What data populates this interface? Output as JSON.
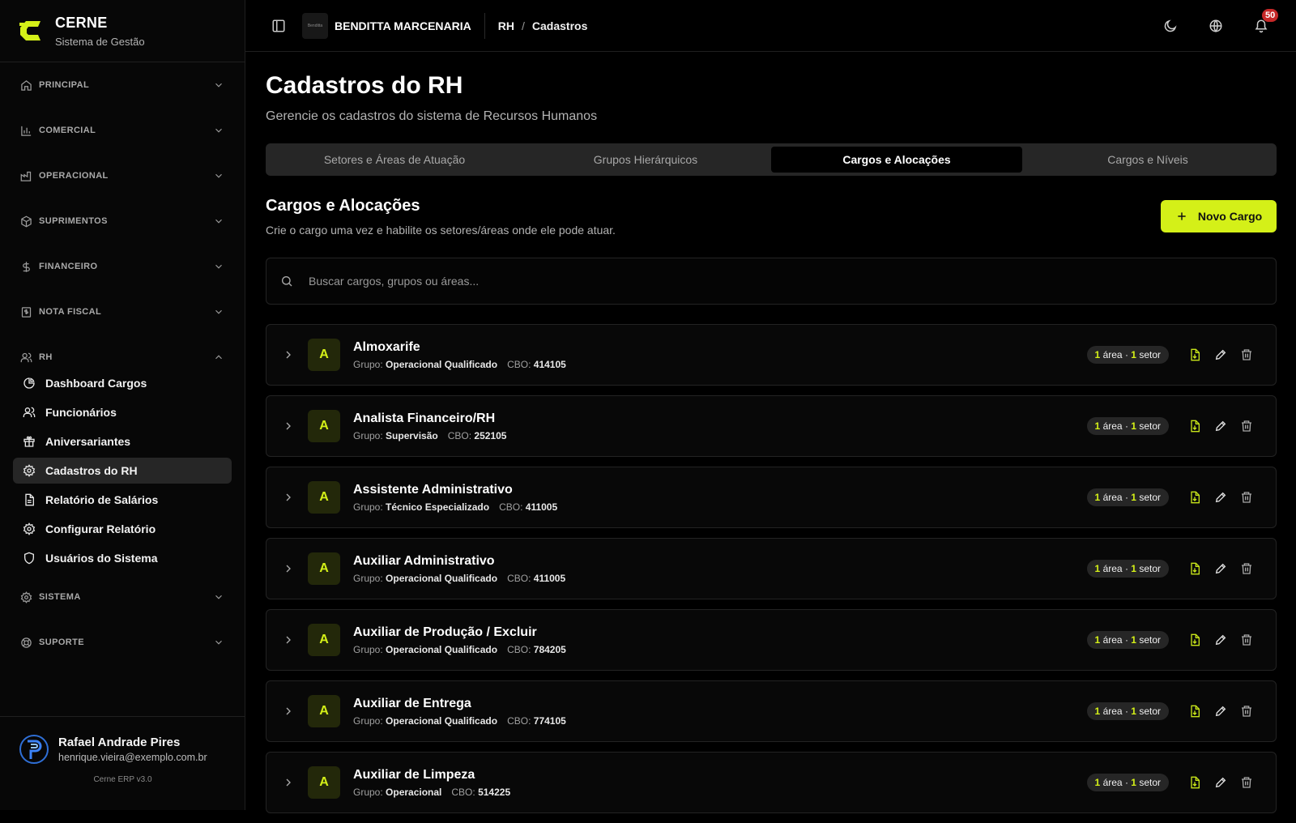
{
  "brand": {
    "name": "CERNE",
    "subtitle": "Sistema de Gestão"
  },
  "sidebar": {
    "sections_top": [
      {
        "label": "PRINCIPAL",
        "icon": "home-icon"
      },
      {
        "label": "COMERCIAL",
        "icon": "bar-chart-icon"
      },
      {
        "label": "OPERACIONAL",
        "icon": "factory-icon"
      },
      {
        "label": "SUPRIMENTOS",
        "icon": "package-icon"
      },
      {
        "label": "FINANCEIRO",
        "icon": "dollar-icon"
      },
      {
        "label": "NOTA FISCAL",
        "icon": "receipt-icon"
      }
    ],
    "rh": {
      "label": "RH",
      "expanded": true,
      "items": [
        {
          "label": "Dashboard Cargos",
          "icon": "pie-chart-icon"
        },
        {
          "label": "Funcionários",
          "icon": "users-icon"
        },
        {
          "label": "Aniversariantes",
          "icon": "gift-icon"
        },
        {
          "label": "Cadastros do RH",
          "icon": "gear-icon",
          "active": true
        },
        {
          "label": "Relatório de Salários",
          "icon": "document-icon"
        },
        {
          "label": "Configurar Relatório",
          "icon": "gear-icon"
        },
        {
          "label": "Usuários do Sistema",
          "icon": "shield-icon"
        }
      ]
    },
    "sections_bottom": [
      {
        "label": "SISTEMA",
        "icon": "gear-icon"
      },
      {
        "label": "SUPORTE",
        "icon": "lifebuoy-icon"
      }
    ],
    "user": {
      "name": "Rafael Andrade Pires",
      "email": "henrique.vieira@exemplo.com.br"
    },
    "version": "Cerne ERP v3.0"
  },
  "topbar": {
    "company_name": "BENDITTA MARCENARIA",
    "company_logo_text": "Benditta",
    "breadcrumb": [
      "RH",
      "Cadastros"
    ],
    "breadcrumb_sep": "/",
    "notification_count": "50"
  },
  "page": {
    "title": "Cadastros do RH",
    "subtitle": "Gerencie os cadastros do sistema de Recursos Humanos",
    "tabs": [
      {
        "label": "Setores e Áreas de Atuação"
      },
      {
        "label": "Grupos Hierárquicos"
      },
      {
        "label": "Cargos e Alocações",
        "active": true
      },
      {
        "label": "Cargos e Níveis"
      }
    ],
    "section": {
      "title": "Cargos e Alocações",
      "subtitle": "Crie o cargo uma vez e habilite os setores/áreas onde ele pode atuar.",
      "new_button": "Novo Cargo"
    },
    "search": {
      "placeholder": "Buscar cargos, grupos ou áreas...",
      "value": ""
    },
    "labels": {
      "group": "Grupo:",
      "cbo": "CBO:",
      "area": "área",
      "setor": "setor",
      "dot": "·"
    },
    "cargos": [
      {
        "letter": "A",
        "name": "Almoxarife",
        "group": "Operacional Qualificado",
        "cbo": "414105",
        "areas": "1",
        "setores": "1"
      },
      {
        "letter": "A",
        "name": "Analista Financeiro/RH",
        "group": "Supervisão",
        "cbo": "252105",
        "areas": "1",
        "setores": "1"
      },
      {
        "letter": "A",
        "name": "Assistente Administrativo",
        "group": "Técnico Especializado",
        "cbo": "411005",
        "areas": "1",
        "setores": "1"
      },
      {
        "letter": "A",
        "name": "Auxiliar Administrativo",
        "group": "Operacional Qualificado",
        "cbo": "411005",
        "areas": "1",
        "setores": "1"
      },
      {
        "letter": "A",
        "name": "Auxiliar de Produção / Excluir",
        "group": "Operacional Qualificado",
        "cbo": "784205",
        "areas": "1",
        "setores": "1"
      },
      {
        "letter": "A",
        "name": "Auxiliar de Entrega",
        "group": "Operacional Qualificado",
        "cbo": "774105",
        "areas": "1",
        "setores": "1"
      },
      {
        "letter": "A",
        "name": "Auxiliar de Limpeza",
        "group": "Operacional",
        "cbo": "514225",
        "areas": "1",
        "setores": "1"
      }
    ]
  },
  "colors": {
    "accent": "#d4f018",
    "background": "#000000",
    "badge": "#c62828"
  }
}
